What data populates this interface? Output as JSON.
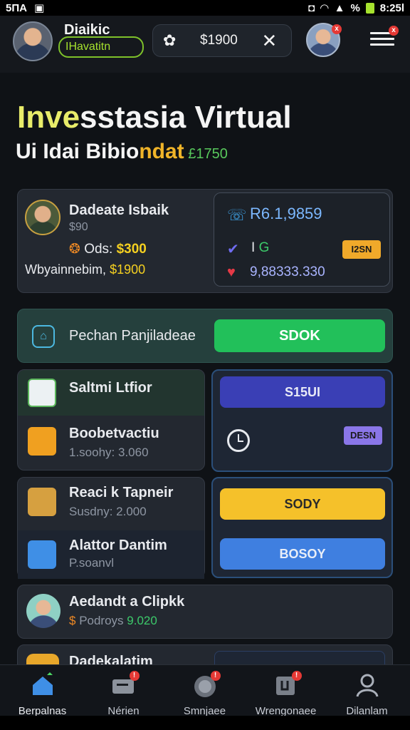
{
  "status_bar": {
    "left_text": "5ΠA",
    "time": "8:25l",
    "percent": "%"
  },
  "header": {
    "profile_name": "Diaikic",
    "profile_tag": "IHavatitn",
    "balance": "$1900",
    "menu_icon": "hamburger-icon"
  },
  "hero": {
    "title_highlight": "Inve",
    "title_rest": "sstasia Virtual",
    "subtitle_main": "Ui Idai Bibio",
    "subtitle_gold": "ndat",
    "subtitle_small": " £1750"
  },
  "match_card": {
    "name": "Dadeate Isbaik",
    "sub": "$90",
    "odds_label": " Ods: ",
    "odds_value": "$300",
    "win_label": "Wbyainnebim, ",
    "win_value": "$1900",
    "ref": "R6.1,9859",
    "ig_prefix": "I ",
    "ig_icon": "G",
    "tag": "I2SN",
    "big_number": "9,88333.330"
  },
  "promo": {
    "label": "Pechan Panjiladeae",
    "button": "SDOK"
  },
  "list1": {
    "row_a_title": "Saltmi Ltfior",
    "row_b_title": "Boobetvactiu",
    "row_b_sub": "1.soohy: 3.060",
    "button": "S15UI",
    "tag": "DESN"
  },
  "list2": {
    "row_a_title": "Reaci k Tapneir",
    "row_a_sub": "Susdny: 2.000",
    "row_b_title": "Alattor Dantim",
    "row_b_sub": "P.soanvl",
    "button_a": "SODY",
    "button_b": "BOSOY"
  },
  "agent_card": {
    "title": "Aedandt a Clipkk",
    "sub_prefix": "$ ",
    "sub_mid": "Podroys ",
    "sub_value": "9.020"
  },
  "partial_card": {
    "title": "Dadekalatim"
  },
  "nav": {
    "items": [
      {
        "label": "Berpalnas",
        "icon": "home-icon"
      },
      {
        "label": "Nérien",
        "icon": "ticket-icon"
      },
      {
        "label": "Smnjaee",
        "icon": "chip-icon"
      },
      {
        "label": "Wrengonaee",
        "icon": "wallet-icon"
      },
      {
        "label": "Dilanlam",
        "icon": "user-icon"
      }
    ]
  },
  "colors": {
    "accent_green": "#22c05a",
    "accent_yellow": "#f5c12a",
    "accent_blue": "#3f7fe0",
    "panel": "#232830"
  }
}
